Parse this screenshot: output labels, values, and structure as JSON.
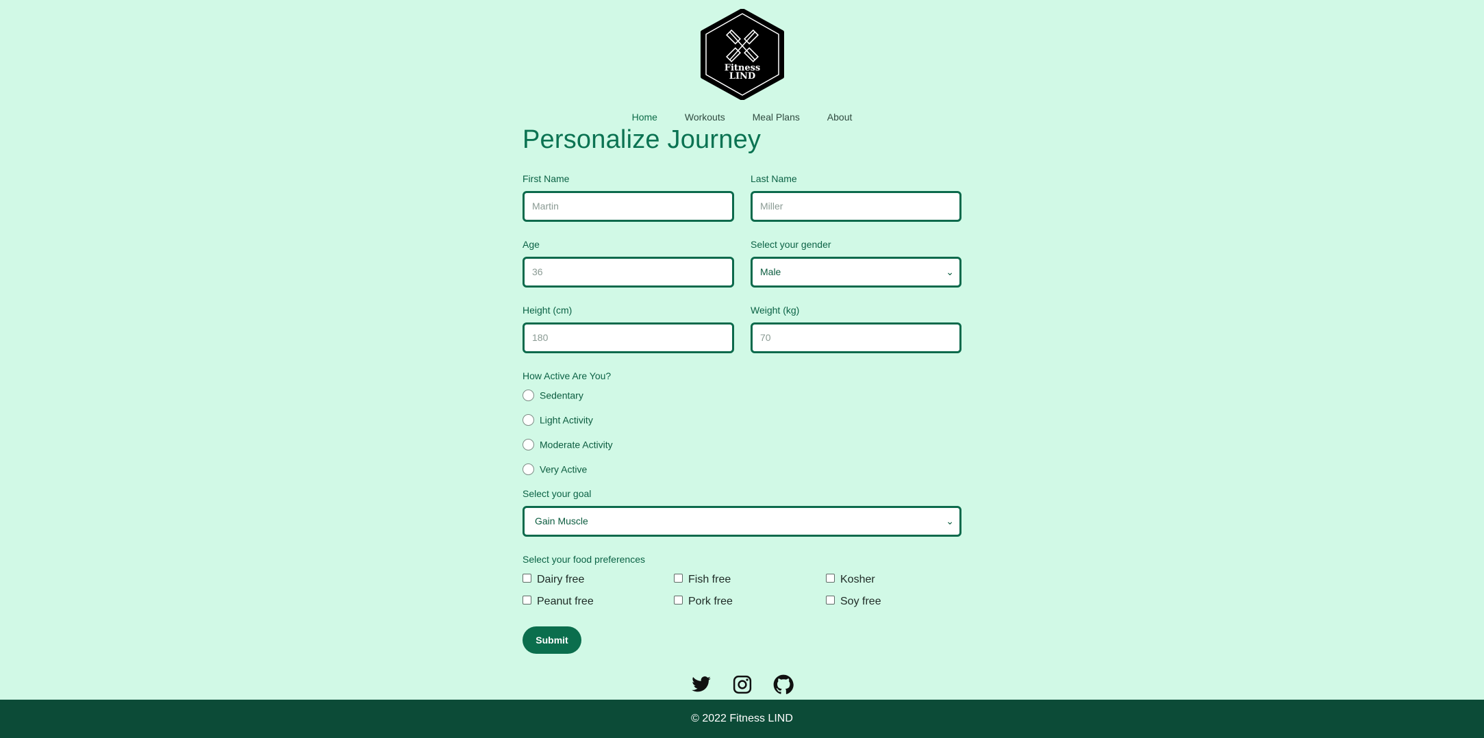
{
  "logo": {
    "line1": "Fitness",
    "line2": "LIND"
  },
  "nav": {
    "items": [
      "Home",
      "Workouts",
      "Meal Plans",
      "About"
    ]
  },
  "page_title": "Personalize Journey",
  "form": {
    "first_name": {
      "label": "First Name",
      "placeholder": "Martin"
    },
    "last_name": {
      "label": "Last Name",
      "placeholder": "Miller"
    },
    "age": {
      "label": "Age",
      "placeholder": "36"
    },
    "gender": {
      "label": "Select your gender",
      "value": "Male"
    },
    "height": {
      "label": "Height (cm)",
      "placeholder": "180"
    },
    "weight": {
      "label": "Weight (kg)",
      "placeholder": "70"
    },
    "activity": {
      "label": "How Active Are You?",
      "options": [
        "Sedentary",
        "Light Activity",
        "Moderate Activity",
        "Very Active"
      ]
    },
    "goal": {
      "label": "Select your goal",
      "value": "Gain Muscle"
    },
    "food": {
      "label": "Select your food preferences",
      "options": [
        "Dairy free",
        "Fish free",
        "Kosher",
        "Peanut free",
        "Pork free",
        "Soy free"
      ]
    },
    "submit_label": "Submit"
  },
  "social": [
    "twitter-icon",
    "instagram-icon",
    "github-icon"
  ],
  "footer": {
    "text": "© 2022 Fitness LIND"
  },
  "colors": {
    "background": "#d1f9e6",
    "accent": "#0b6e4d",
    "footer": "#0c4b37"
  }
}
